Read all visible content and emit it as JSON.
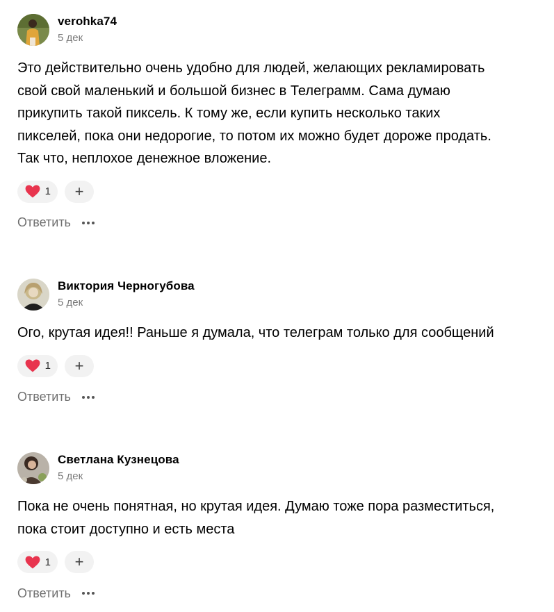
{
  "comments": [
    {
      "author": "verohka74",
      "date": "5 дек",
      "text": "Это действительно очень удобно для людей, желающих рекламировать свой свой маленький и большой бизнес в Телеграмм. Сама думаю прикупить такой пиксель. К тому же, если купить несколько таких пикселей, пока они недорогие, то потом их можно будет дороже продать. Так что, неплохое денежное вложение.",
      "likes": "1",
      "reply_label": "Ответить",
      "avatar_icon": "user-photo-avatar"
    },
    {
      "author": "Виктория Черногубова",
      "date": "5 дек",
      "text": "Ого, крутая идея!! Раньше я думала, что телеграм только для сообщений",
      "likes": "1",
      "reply_label": "Ответить",
      "avatar_icon": "user-photo-avatar"
    },
    {
      "author": "Светлана Кузнецова",
      "date": "5 дек",
      "text": "Пока не очень понятная, но крутая идея. Думаю тоже пора разместиться, пока стоит доступно и есть места",
      "likes": "1",
      "reply_label": "Ответить",
      "avatar_icon": "user-photo-avatar"
    }
  ],
  "add_reaction_symbol": "+",
  "colors": {
    "heart": "#e8344e",
    "pill_bg": "#f2f2f2",
    "muted_text": "#7a7a7a"
  }
}
